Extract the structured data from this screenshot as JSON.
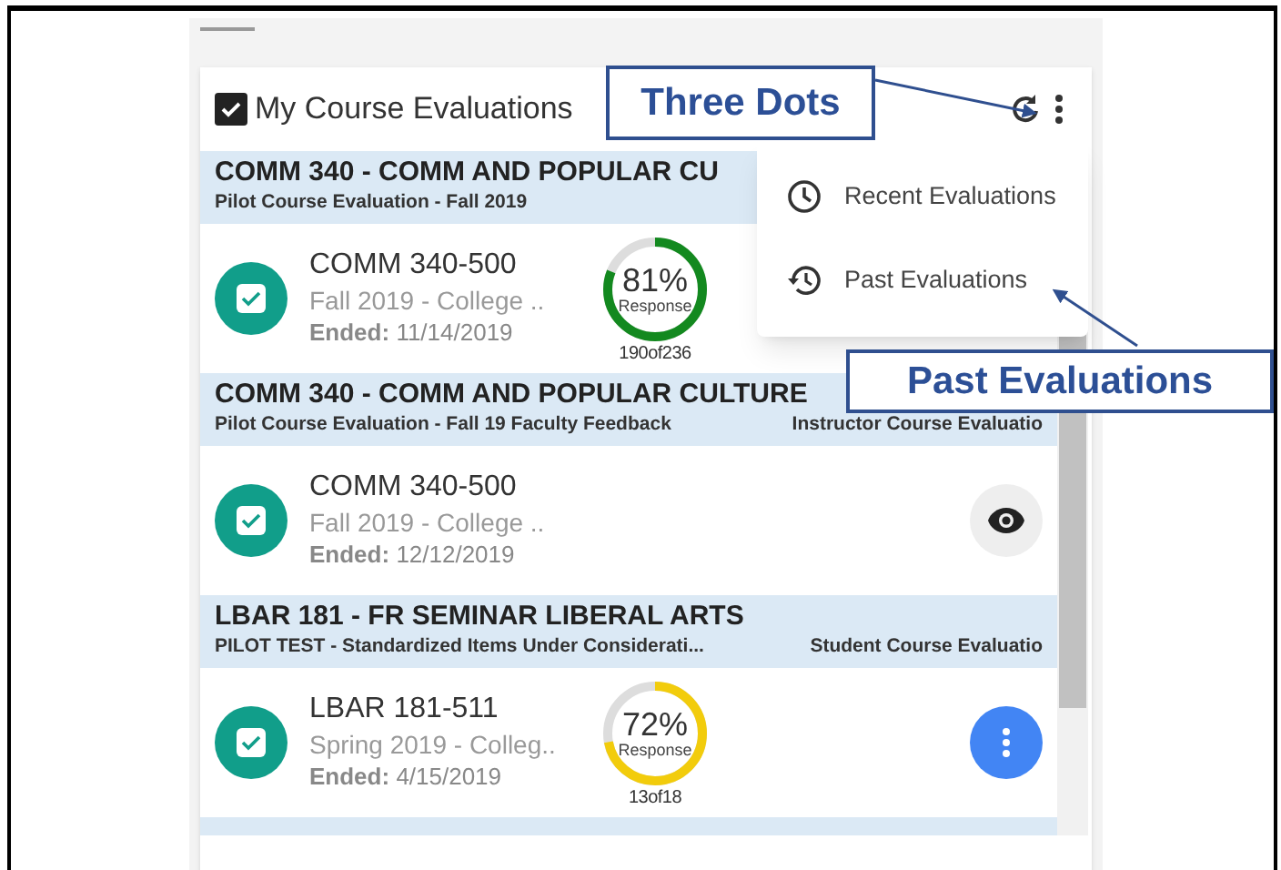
{
  "header": {
    "checked": true,
    "title": "My Course Evaluations"
  },
  "sections": [
    {
      "title": "COMM 340 - COMM AND POPULAR CU",
      "subtitle": "Pilot Course Evaluation - Fall 2019",
      "item": {
        "code": "COMM 340-500",
        "term": "Fall 2019 - College ..",
        "ended_label": "Ended:",
        "ended": "11/14/2019",
        "response": {
          "percent": "81%",
          "label": "Response",
          "count": "190of236",
          "level": 0.81,
          "color": "#13891f"
        }
      }
    },
    {
      "title": "COMM 340 - COMM AND POPULAR CULTURE",
      "subtitle": "Pilot Course Evaluation - Fall 19 Faculty Feedback",
      "type": "Instructor Course Evaluatio",
      "item": {
        "code": "COMM 340-500",
        "term": "Fall 2019 - College ..",
        "ended_label": "Ended:",
        "ended": "12/12/2019",
        "kind": "view"
      }
    },
    {
      "title": "LBAR 181 - FR SEMINAR LIBERAL ARTS",
      "subtitle": "PILOT TEST - Standardized Items Under Considerati...",
      "type": "Student Course Evaluatio",
      "item": {
        "code": "LBAR 181-511",
        "term": "Spring 2019 - Colleg..",
        "ended_label": "Ended:",
        "ended": "4/15/2019",
        "response": {
          "percent": "72%",
          "label": "Response",
          "count": "13of18",
          "level": 0.72,
          "color": "#f2cc0c"
        },
        "kind": "more"
      }
    }
  ],
  "menu": [
    {
      "kind": "recent",
      "label": "Recent Evaluations"
    },
    {
      "kind": "past",
      "label": "Past Evaluations"
    }
  ],
  "callouts": [
    {
      "label": "Three Dots"
    },
    {
      "label": "Past Evaluations"
    }
  ]
}
